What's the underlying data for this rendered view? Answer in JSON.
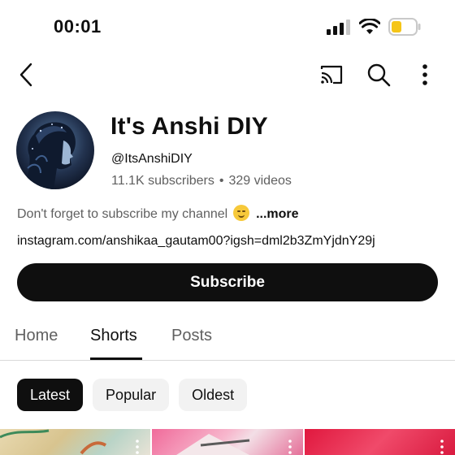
{
  "status_bar": {
    "time": "00:01"
  },
  "top_bar": {
    "back_icon": "chevron-left-icon",
    "cast_icon": "cast-icon",
    "search_icon": "search-icon",
    "more_icon": "more-vertical-icon"
  },
  "channel": {
    "name": "It's Anshi DIY",
    "handle": "@ItsAnshiDIY",
    "subscribers": "11.1K subscribers",
    "separator": "•",
    "videos": "329 videos",
    "description": "Don't forget to subscribe my channel",
    "description_more": "...more",
    "link": "instagram.com/anshikaa_gautam00?igsh=dml2b3ZmYjdnY29j"
  },
  "actions": {
    "subscribe_label": "Subscribe"
  },
  "tabs": [
    {
      "label": "Home",
      "active": false
    },
    {
      "label": "Shorts",
      "active": true
    },
    {
      "label": "Posts",
      "active": false
    }
  ],
  "chips": [
    {
      "label": "Latest",
      "selected": true
    },
    {
      "label": "Popular",
      "selected": false
    },
    {
      "label": "Oldest",
      "selected": false
    }
  ],
  "colors": {
    "text_primary": "#0f0f0f",
    "text_secondary": "#606060",
    "chip_bg": "#f2f2f2",
    "battery": "#f5c518"
  }
}
